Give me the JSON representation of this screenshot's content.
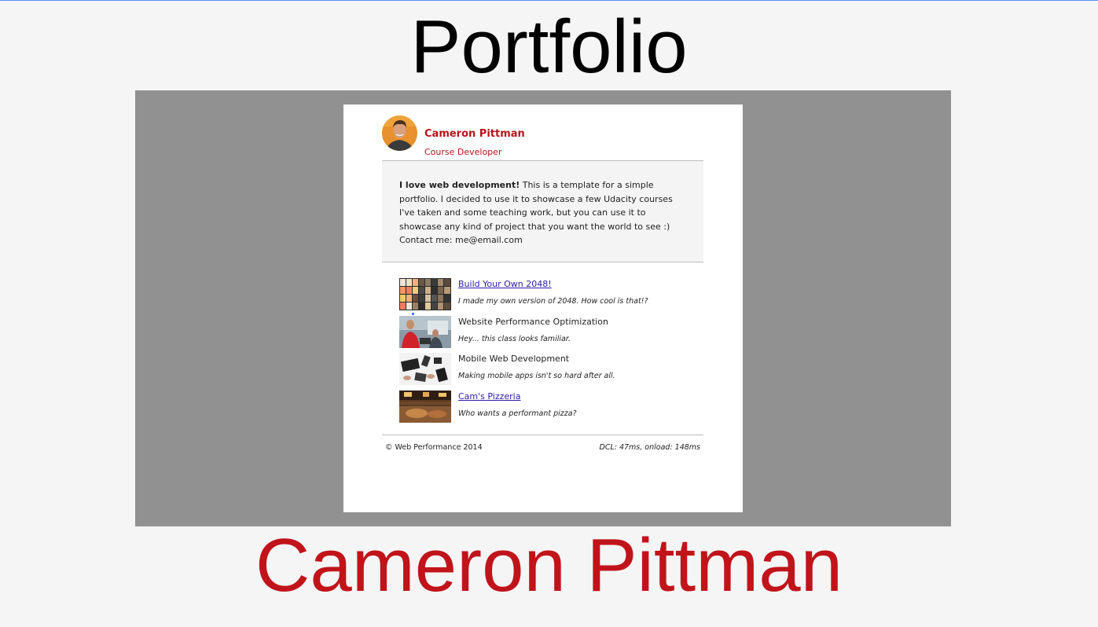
{
  "slide": {
    "title": "Portfolio",
    "subtitle": "Cameron Pittman"
  },
  "colors": {
    "accent": "#b5151b",
    "stage": "#919191",
    "link": "#2b1aa8"
  },
  "profile": {
    "name": "Cameron Pittman",
    "role": "Course Developer",
    "avatar_icon": "avatar-photo-icon"
  },
  "about": {
    "lead": "I love web development!",
    "body": "This is a template for a simple portfolio. I decided to use it to showcase a few Udacity courses I've taken and some teaching work, but you can use it to showcase any kind of project that you want the world to see :)",
    "contact": "Contact me: me@email.com"
  },
  "projects": [
    {
      "title": "Build Your Own 2048!",
      "desc": "I made my own version of 2048. How cool is that!?",
      "link": true,
      "thumb": "2048-grid-thumbnail"
    },
    {
      "title": "Website Performance Optimization",
      "desc": "Hey... this class looks familiar.",
      "link": false,
      "thumb": "classroom-photo-thumbnail"
    },
    {
      "title": "Mobile Web Development",
      "desc": "Making mobile apps isn't so hard after all.",
      "link": false,
      "thumb": "devices-photo-thumbnail"
    },
    {
      "title": "Cam's Pizzeria",
      "desc": "Who wants a performant pizza?",
      "link": true,
      "thumb": "pizzeria-photo-thumbnail"
    }
  ],
  "footer": {
    "copyright": "© Web Performance 2014",
    "timing": "DCL: 47ms, onload: 148ms"
  }
}
